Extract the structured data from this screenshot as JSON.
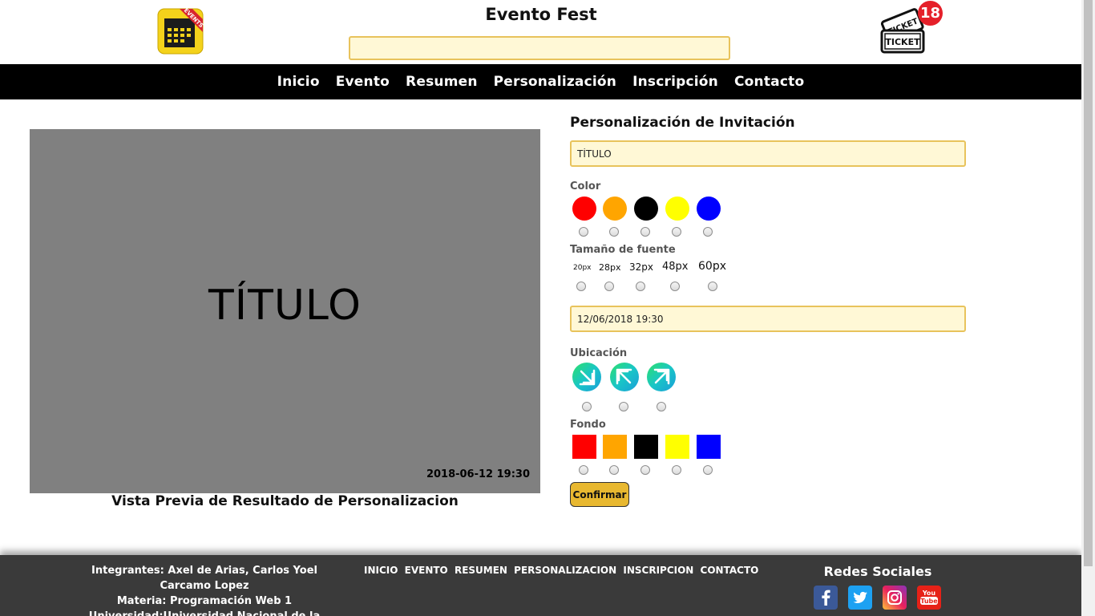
{
  "header": {
    "site_title": "Evento Fest",
    "logo_text": "EVENTS",
    "search_value": "",
    "ticket_text_top": "TICKET",
    "ticket_text_bottom": "TICKET",
    "ticket_count": "18"
  },
  "nav": {
    "items": [
      "Inicio",
      "Evento",
      "Resumen",
      "Personalización",
      "Inscripción",
      "Contacto"
    ]
  },
  "preview": {
    "title": "TÍTULO",
    "date": "2018-06-12 19:30",
    "caption": "Vista Previa de Resultado de Personalizacion",
    "background": "#808080"
  },
  "form": {
    "heading": "Personalización de Invitación",
    "title_value": "TÍTULO",
    "color_label": "Color",
    "colors": [
      "#ff0000",
      "#ffa500",
      "#000000",
      "#ffff00",
      "#0000ff"
    ],
    "font_size_label": "Tamaño de fuente",
    "font_sizes": [
      "20px",
      "28px",
      "32px",
      "48px",
      "60px"
    ],
    "datetime_value": "12/06/2018 19:30",
    "location_label": "Ubicación",
    "location_icons": [
      "arrow-down-right-icon",
      "arrow-up-left-icon",
      "arrow-up-right-icon"
    ],
    "background_label": "Fondo",
    "backgrounds": [
      "#ff0000",
      "#ffa500",
      "#000000",
      "#ffff00",
      "#0000ff"
    ],
    "confirm_label": "Confirmar"
  },
  "footer": {
    "members": "Integrantes: Axel de Arias, Carlos Yoel Carcamo Lopez",
    "subject": "Materia: Programación Web 1",
    "university": "Universidad:Universidad Nacional de la Matanza",
    "links": [
      "INICIO",
      "EVENTO",
      "RESUMEN",
      "PERSONALIZACION",
      "INSCRIPCION",
      "CONTACTO"
    ],
    "social_title": "Redes Sociales",
    "social": [
      "facebook-icon",
      "twitter-icon",
      "instagram-icon",
      "youtube-icon"
    ],
    "youtube_text_top": "You",
    "youtube_text_bottom": "Tube"
  }
}
